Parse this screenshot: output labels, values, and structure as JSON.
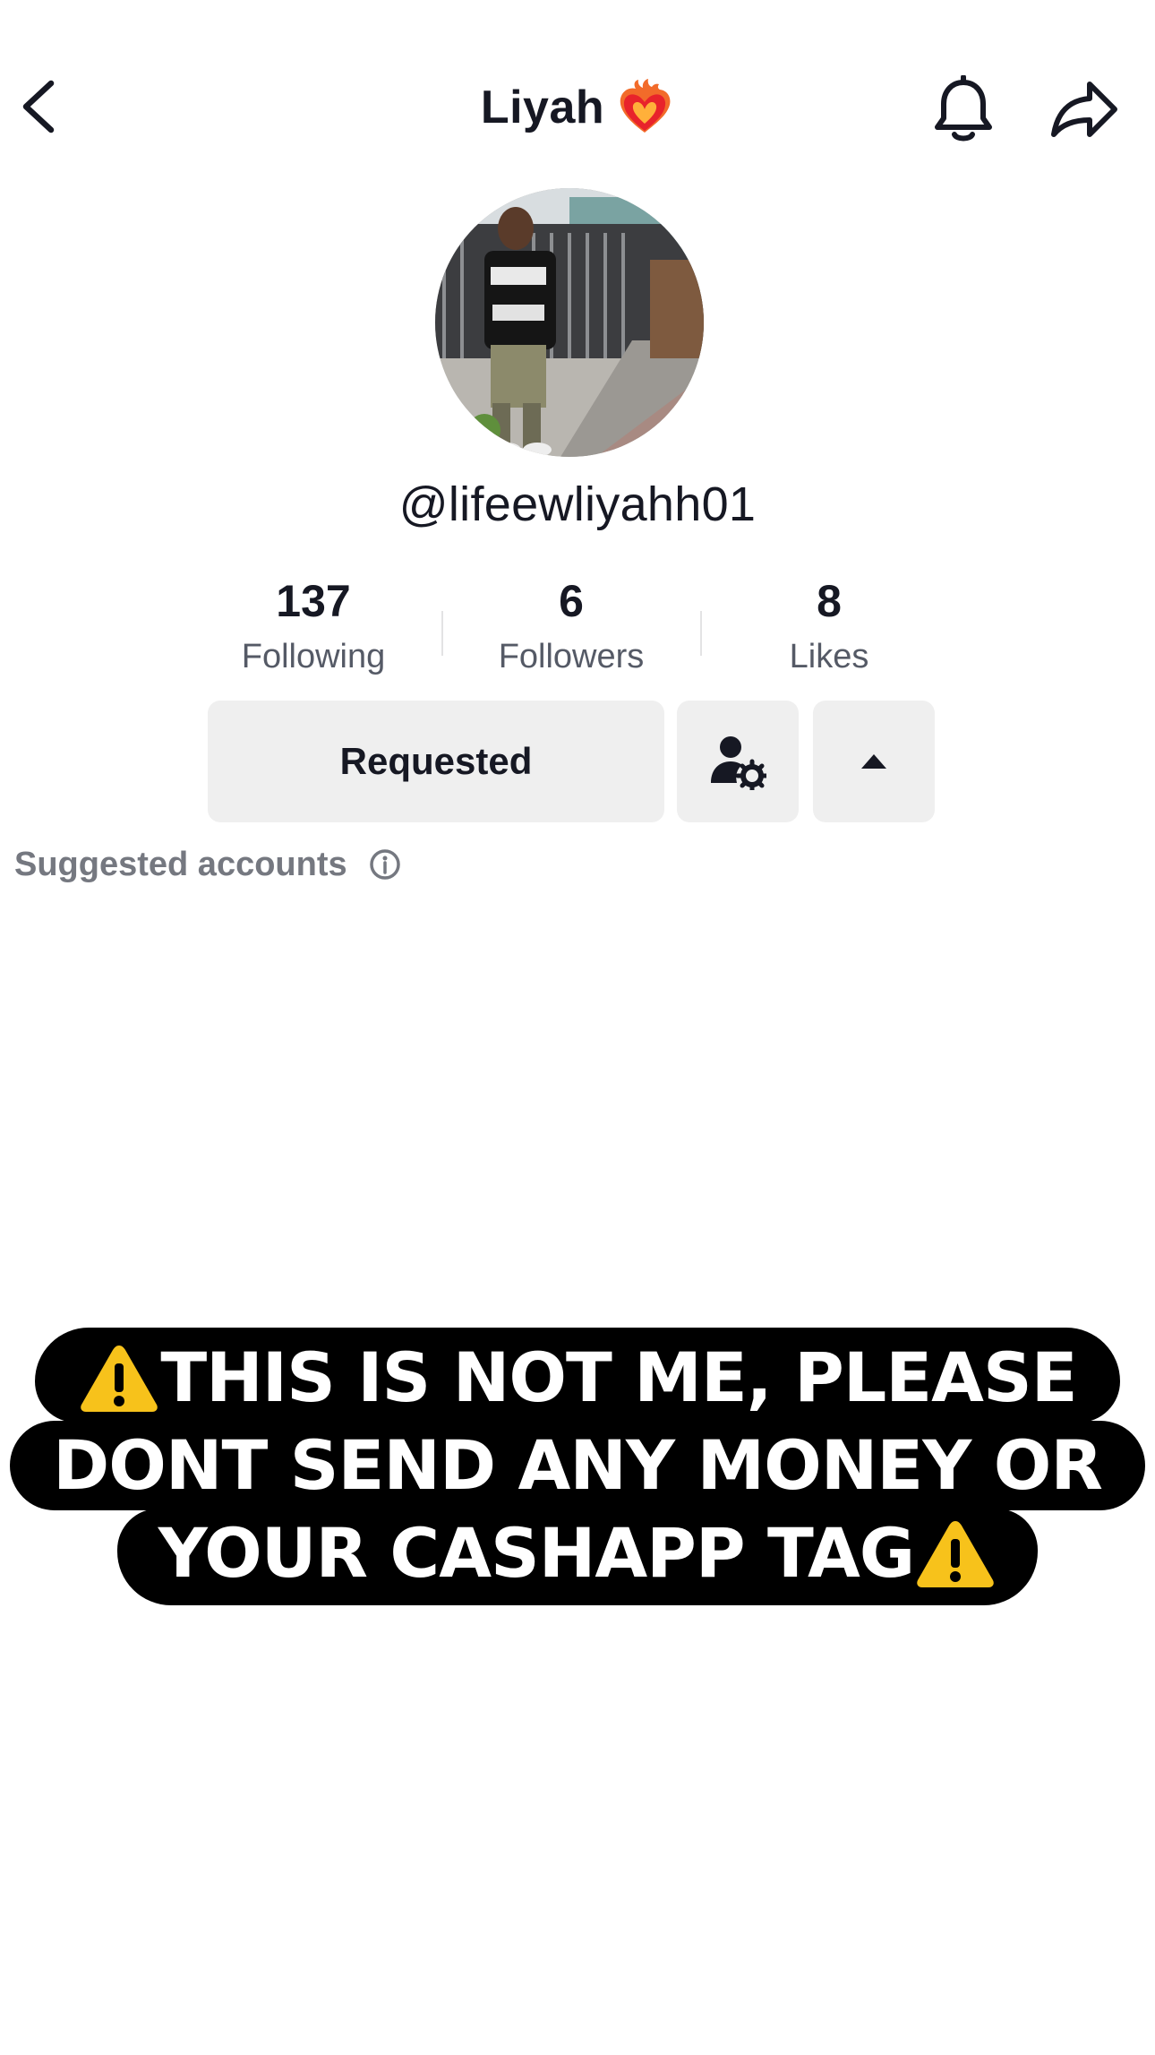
{
  "header": {
    "title": "Liyah",
    "title_emoji": "heart-on-fire-icon",
    "back_icon": "chevron-left-icon",
    "notification_icon": "bell-icon",
    "share_icon": "share-arrow-icon"
  },
  "profile": {
    "username": "@lifeewliyahh01",
    "avatar": "profile-photo"
  },
  "stats": [
    {
      "value": "137",
      "label": "Following"
    },
    {
      "value": "6",
      "label": "Followers"
    },
    {
      "value": "8",
      "label": "Likes"
    }
  ],
  "actions": {
    "requested_label": "Requested",
    "settings_icon": "user-settings-icon",
    "expand_icon": "caret-up-icon"
  },
  "suggested": {
    "label": "Suggested accounts",
    "info_icon": "info-icon"
  },
  "warning_overlay": {
    "lines": [
      "THIS IS NOT ME, PLEASE",
      "DONT SEND ANY MONEY OR",
      "YOUR CASHAPP TAG"
    ],
    "icon": "warning-sign-icon",
    "background": "#000000",
    "text_color": "#ffffff"
  },
  "colors": {
    "button_bg": "#efefef",
    "text_primary": "#161823",
    "text_secondary": "#555a66",
    "warning_yellow": "#f7c21b"
  }
}
